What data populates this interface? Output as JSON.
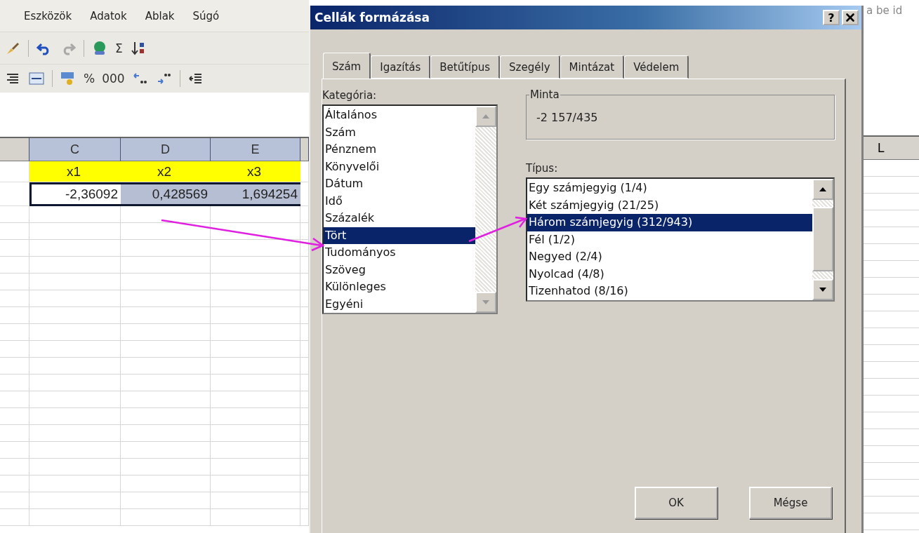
{
  "menu": [
    "Eszközök",
    "Adatok",
    "Ablak",
    "Súgó"
  ],
  "toolbar": {
    "sum": "Σ",
    "percent": "%",
    "thousands": "000"
  },
  "sheet": {
    "columns": [
      "C",
      "D",
      "E"
    ],
    "rows": [
      [
        {
          "text": "x1",
          "selected": false,
          "active": false,
          "kind": "label"
        },
        {
          "text": "x2",
          "selected": false,
          "active": false,
          "kind": "label"
        },
        {
          "text": "x3",
          "selected": false,
          "active": false,
          "kind": "label"
        }
      ],
      [
        {
          "text": "-2,36092",
          "selected": true,
          "active": true,
          "kind": "value"
        },
        {
          "text": "0,428569",
          "selected": true,
          "active": false,
          "kind": "value"
        },
        {
          "text": "1,694254",
          "selected": true,
          "active": false,
          "kind": "value"
        }
      ]
    ]
  },
  "right_pane": {
    "text": "a be id",
    "column": "L"
  },
  "dialog": {
    "title": "Cellák formázása",
    "help": "?",
    "tabs": [
      {
        "label": "Szám",
        "selected": true
      },
      {
        "label": "Igazítás",
        "selected": false
      },
      {
        "label": "Betűtípus",
        "selected": false
      },
      {
        "label": "Szegély",
        "selected": false
      },
      {
        "label": "Mintázat",
        "selected": false
      },
      {
        "label": "Védelem",
        "selected": false
      }
    ],
    "category": {
      "label": "Kategória:",
      "items": [
        {
          "label": "Általános",
          "selected": false
        },
        {
          "label": "Szám",
          "selected": false
        },
        {
          "label": "Pénznem",
          "selected": false
        },
        {
          "label": "Könyvelői",
          "selected": false
        },
        {
          "label": "Dátum",
          "selected": false
        },
        {
          "label": "Idő",
          "selected": false
        },
        {
          "label": "Százalék",
          "selected": false
        },
        {
          "label": "Tört",
          "selected": true
        },
        {
          "label": "Tudományos",
          "selected": false
        },
        {
          "label": "Szöveg",
          "selected": false
        },
        {
          "label": "Különleges",
          "selected": false
        },
        {
          "label": "Egyéni",
          "selected": false
        }
      ]
    },
    "sample": {
      "label": "Minta",
      "value": "-2 157/435"
    },
    "type": {
      "label": "Típus:",
      "items": [
        {
          "label": "Egy számjegyig (1/4)",
          "selected": false
        },
        {
          "label": "Két számjegyig (21/25)",
          "selected": false
        },
        {
          "label": "Három számjegyig (312/943)",
          "selected": true
        },
        {
          "label": "Fél (1/2)",
          "selected": false
        },
        {
          "label": "Negyed (2/4)",
          "selected": false
        },
        {
          "label": "Nyolcad (4/8)",
          "selected": false
        },
        {
          "label": "Tizenhatod (8/16)",
          "selected": false
        }
      ]
    },
    "buttons": [
      "OK",
      "Mégse"
    ]
  }
}
